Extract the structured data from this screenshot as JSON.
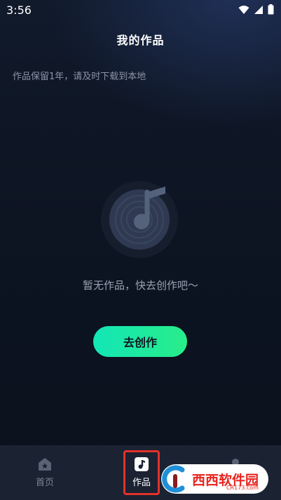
{
  "status": {
    "time": "3:56"
  },
  "header": {
    "title": "我的作品"
  },
  "notice": "作品保留1年，请及时下载到本地",
  "empty_state": {
    "message": "暂无作品，快去创作吧～",
    "illustration": "music-disc-icon"
  },
  "actions": {
    "create_label": "去创作"
  },
  "tabs": [
    {
      "label": "首页",
      "icon": "home-icon",
      "active": false
    },
    {
      "label": "作品",
      "icon": "music-note-icon",
      "active": true
    },
    {
      "label": "",
      "icon": "profile-icon",
      "active": false
    }
  ],
  "watermark": {
    "brand": "西西软件园",
    "domain": "CR173.com"
  },
  "colors": {
    "accent_start": "#13e6b6",
    "accent_end": "#28ed8a",
    "highlight": "#e2322b",
    "background": "#0d1422"
  }
}
